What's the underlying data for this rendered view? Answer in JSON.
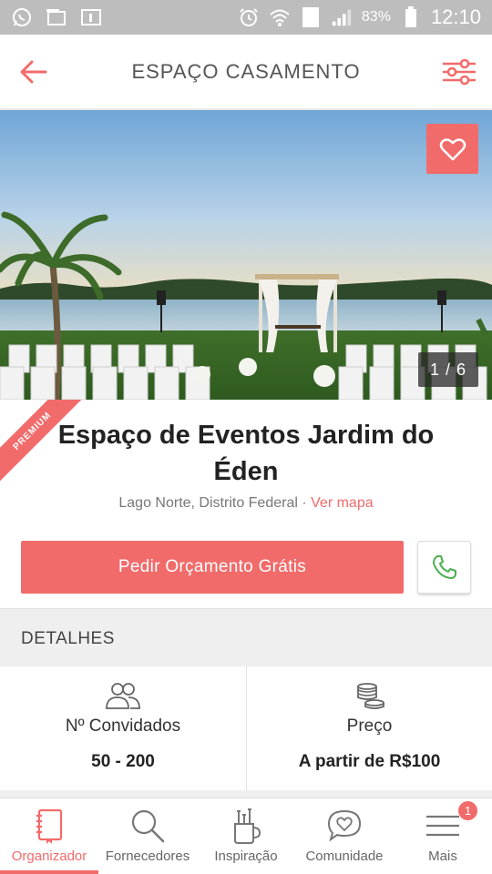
{
  "status_bar": {
    "battery_percent": "83%",
    "time": "12:10",
    "sim_label": "1",
    "icons": [
      "whatsapp-icon",
      "notification-icon",
      "notification-icon",
      "alarm-icon",
      "wifi-icon",
      "sim-icon",
      "signal-icon",
      "battery-icon"
    ]
  },
  "header": {
    "title": "ESPAÇO CASAMENTO",
    "back_icon": "arrow-left-icon",
    "filter_icon": "sliders-icon"
  },
  "gallery": {
    "counter": "1 / 6",
    "favorite_icon": "heart-icon"
  },
  "venue": {
    "premium_label": "PREMIUM",
    "title": "Espaço de Eventos Jardim do Éden",
    "location": "Lago Norte, Distrito Federal",
    "separator": " · ",
    "map_link": "Ver mapa"
  },
  "actions": {
    "quote_button": "Pedir Orçamento Grátis",
    "phone_icon": "phone-icon"
  },
  "details": {
    "section_title": "DETALHES",
    "cards": [
      {
        "icon": "guests-icon",
        "label": "Nº Convidados",
        "value": "50 - 200"
      },
      {
        "icon": "coins-icon",
        "label": "Preço",
        "value": "A partir de R$100"
      }
    ]
  },
  "bottom_nav": {
    "items": [
      {
        "label": "Organizador",
        "icon": "notebook-icon",
        "active": true
      },
      {
        "label": "Fornecedores",
        "icon": "search-icon"
      },
      {
        "label": "Inspiração",
        "icon": "inspiration-icon"
      },
      {
        "label": "Comunidade",
        "icon": "chat-heart-icon"
      },
      {
        "label": "Mais",
        "icon": "menu-icon",
        "badge": "1"
      }
    ]
  },
  "colors": {
    "accent": "#f26b6b",
    "status_bar": "#bdbdbd",
    "text_dark": "#222222",
    "text_muted": "#777777"
  }
}
